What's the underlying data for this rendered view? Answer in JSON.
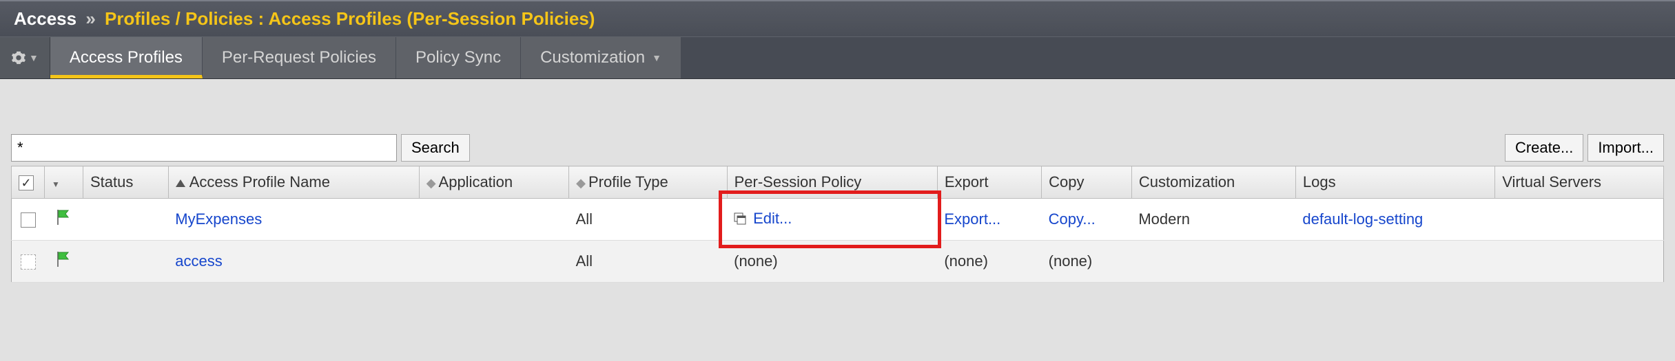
{
  "breadcrumb": {
    "main": "Access",
    "sep": "»",
    "sub": "Profiles / Policies : Access Profiles (Per-Session Policies)"
  },
  "tabs": {
    "t0": "Access Profiles",
    "t1": "Per-Request Policies",
    "t2": "Policy Sync",
    "t3": "Customization"
  },
  "toolbar": {
    "search_value": "*",
    "search_btn": "Search",
    "create_btn": "Create...",
    "import_btn": "Import..."
  },
  "columns": {
    "status": "Status",
    "name": "Access Profile Name",
    "application": "Application",
    "profile_type": "Profile Type",
    "per_session": "Per-Session Policy",
    "export": "Export",
    "copy": "Copy",
    "customization": "Customization",
    "logs": "Logs",
    "virtual_servers": "Virtual Servers"
  },
  "rows": [
    {
      "name": "MyExpenses",
      "application": "",
      "profile_type": "All",
      "per_session": "Edit...",
      "export": "Export...",
      "copy": "Copy...",
      "customization": "Modern",
      "logs": "default-log-setting",
      "virtual_servers": "",
      "highlight_edit": true,
      "chk_dashed": false
    },
    {
      "name": "access",
      "application": "",
      "profile_type": "All",
      "per_session": "(none)",
      "export": "(none)",
      "copy": "(none)",
      "customization": "",
      "logs": "",
      "virtual_servers": "",
      "highlight_edit": false,
      "chk_dashed": true
    }
  ]
}
